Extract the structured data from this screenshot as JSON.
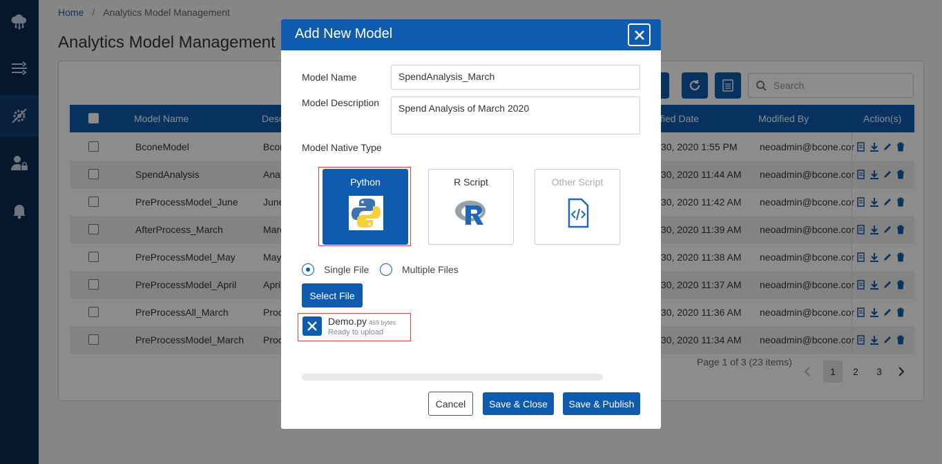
{
  "sidebar": {
    "items": [
      {
        "icon": "cloud-network-icon"
      },
      {
        "icon": "data-flow-icon"
      },
      {
        "icon": "model-settings-icon",
        "active": true
      },
      {
        "icon": "user-lock-icon"
      },
      {
        "icon": "bell-icon"
      }
    ]
  },
  "breadcrumb": {
    "home": "Home",
    "separator": "/",
    "current": "Analytics Model Management"
  },
  "page_title": "Analytics Model Management",
  "toolbar": {
    "search_placeholder": "Search"
  },
  "table": {
    "columns": [
      "Model Name",
      "Desc",
      "fied Date",
      "Modified By",
      "Action(s)"
    ],
    "rows": [
      {
        "name": "BconeModel",
        "desc": "Bcon",
        "date": "30, 2020 1:55 PM",
        "by": "neoadmin@bcone.cor"
      },
      {
        "name": "SpendAnalysis",
        "desc": "Anal",
        "date": "30, 2020 11:44 AM",
        "by": "neoadmin@bcone.cor"
      },
      {
        "name": "PreProcessModel_June",
        "desc": "June",
        "date": "30, 2020 11:42 AM",
        "by": "neoadmin@bcone.cor"
      },
      {
        "name": "AfterProcess_March",
        "desc": "Marc",
        "date": "30, 2020 11:39 AM",
        "by": "neoadmin@bcone.cor"
      },
      {
        "name": "PreProcessModel_May",
        "desc": "May",
        "date": "30, 2020 11:38 AM",
        "by": "neoadmin@bcone.cor"
      },
      {
        "name": "PreProcessModel_April",
        "desc": "April",
        "date": "30, 2020 11:37 AM",
        "by": "neoadmin@bcone.cor"
      },
      {
        "name": "PreProcessAll_March",
        "desc": "Proc",
        "date": "30, 2020 11:36 AM",
        "by": "neoadmin@bcone.cor"
      },
      {
        "name": "PreProcessModel_March",
        "desc": "Proc",
        "date": "30, 2020 11:34 AM",
        "by": "neoadmin@bcone.cor"
      }
    ]
  },
  "pagination": {
    "summary": "Page 1 of 3 (23 items)",
    "pages": [
      "1",
      "2",
      "3"
    ],
    "current": "1"
  },
  "modal": {
    "title": "Add New Model",
    "model_name_label": "Model Name",
    "model_name_value": "SpendAnalysis_March",
    "model_description_label": "Model Description",
    "model_description_value": "Spend Analysis of March 2020",
    "native_type_label": "Model Native Type",
    "types": [
      {
        "label": "Python",
        "icon": "python-logo-icon",
        "state": "selected"
      },
      {
        "label": "R Script",
        "icon": "r-logo-icon",
        "state": "normal"
      },
      {
        "label": "Other Script",
        "icon": "code-file-icon",
        "state": "disabled"
      }
    ],
    "upload_mode": {
      "single": "Single File",
      "multiple": "Multiple Files",
      "selected": "single"
    },
    "select_file_label": "Select File",
    "file": {
      "name": "Demo.py",
      "size": "469 bytes",
      "status": "Ready to upload"
    },
    "upload_progress": 0,
    "buttons": {
      "cancel": "Cancel",
      "save_close": "Save & Close",
      "save_publish": "Save & Publish"
    }
  },
  "colors": {
    "primary": "#0f5bb0",
    "sidebar": "#0b2a52",
    "highlight": "#e04040"
  }
}
